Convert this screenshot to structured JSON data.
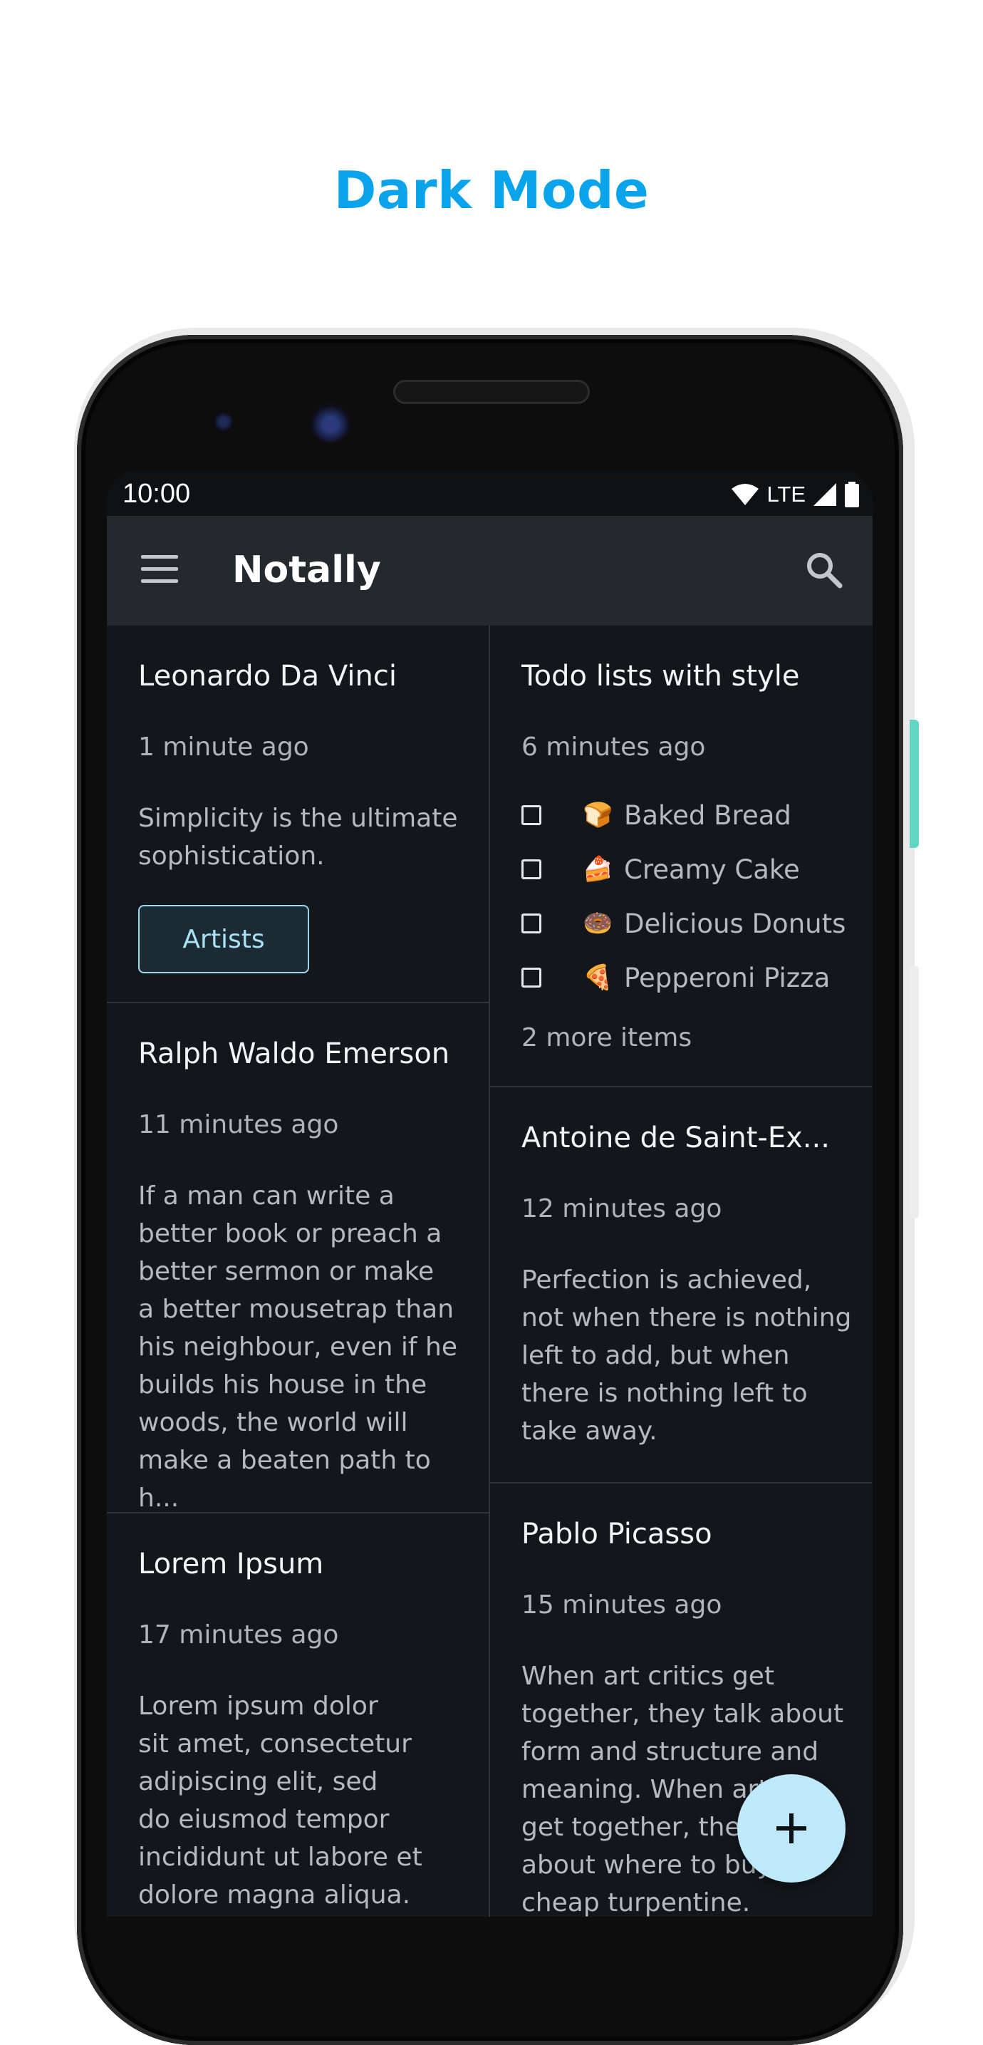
{
  "headline": "Dark Mode",
  "status": {
    "time": "10:00",
    "network": "LTE"
  },
  "toolbar": {
    "title": "Notally"
  },
  "notes_left": [
    {
      "title": "Leonardo Da Vinci",
      "time": "1 minute ago",
      "body_lines": [
        "Simplicity is the ultimate",
        "sophistication."
      ],
      "label": "Artists"
    },
    {
      "title": "Ralph Waldo Emerson",
      "time": "11 minutes ago",
      "body_lines": [
        "If a man can write a",
        "better book or preach a",
        "better sermon or make",
        "a better mousetrap than",
        "his neighbour, even if he",
        "builds his house in the",
        "woods, the world will",
        "make a beaten path to h..."
      ]
    },
    {
      "title": "Lorem Ipsum",
      "time": "17 minutes ago",
      "body_lines": [
        "Lorem ipsum dolor",
        "sit amet, consectetur",
        "adipiscing elit, sed",
        "do eiusmod tempor",
        "incididunt ut labore et",
        "dolore magna aliqua."
      ]
    }
  ],
  "notes_right": [
    {
      "title": "Todo lists with style",
      "time": "6 minutes ago",
      "items": [
        {
          "emoji": "🍞",
          "text": "Baked Bread"
        },
        {
          "emoji": "🍰",
          "text": "Creamy Cake"
        },
        {
          "emoji": "🍩",
          "text": "Delicious Donuts"
        },
        {
          "emoji": "🍕",
          "text": "Pepperoni Pizza"
        }
      ],
      "more": "2 more items"
    },
    {
      "title": "Antoine de Saint-Ex...",
      "time": "12 minutes ago",
      "body_lines": [
        "Perfection is achieved,",
        "not when there is nothing",
        "left to add, but when",
        "there is nothing left to",
        "take away."
      ]
    },
    {
      "title": "Pablo Picasso",
      "time": "15 minutes ago",
      "body_lines": [
        "When art critics get",
        "together, they talk about",
        "form and structure and",
        "meaning. When artists",
        "get together, they talk",
        "about where to buy",
        "cheap turpentine."
      ]
    }
  ],
  "colors": {
    "headline": "#0aa4ec",
    "screen_bg": "#13171b",
    "toolbar_bg": "#24292e",
    "chip_border": "#9fd8ee",
    "fab_bg": "#bfe9fb"
  },
  "icons": [
    "menu-icon",
    "search-icon",
    "wifi-icon",
    "signal-icon",
    "battery-icon",
    "checkbox-icon",
    "plus-icon"
  ]
}
